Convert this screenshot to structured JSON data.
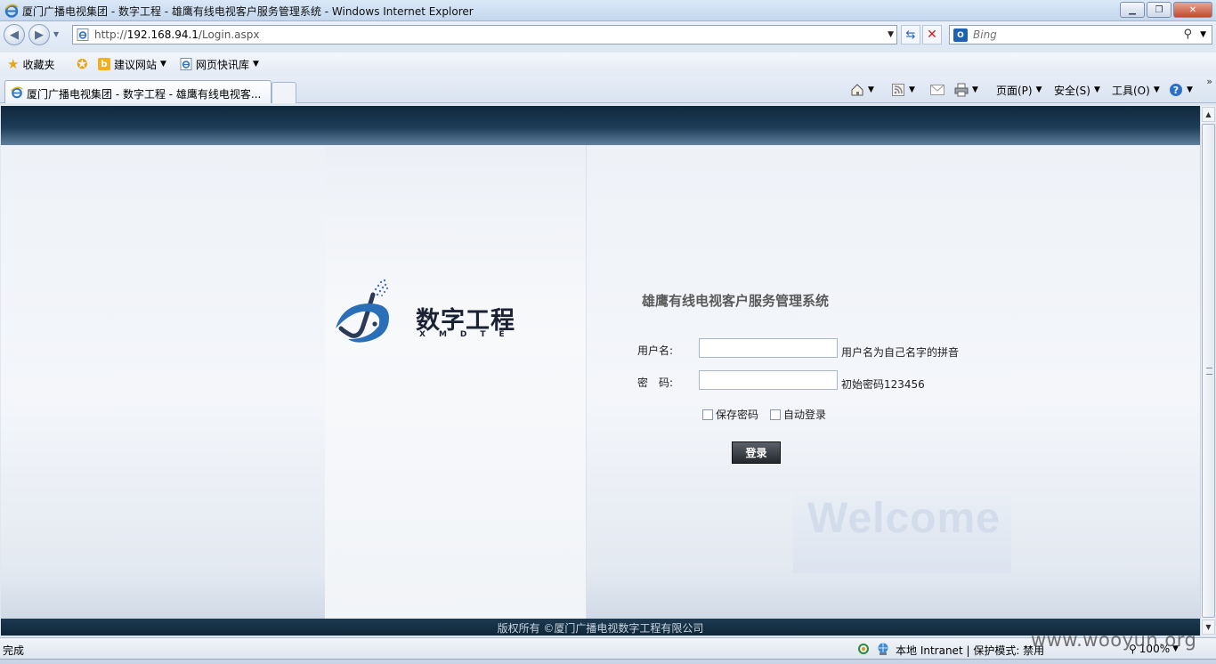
{
  "window": {
    "title": "厦门广播电视集团 - 数字工程 - 雄鹰有线电视客户服务管理系统 - Windows Internet Explorer",
    "controls": {
      "minimize": "▁",
      "maximize": "❐",
      "close": "✕"
    }
  },
  "address_bar": {
    "url_prefix": "http://",
    "url_host": "192.168.94.1",
    "url_path": "/Login.aspx",
    "search_placeholder": "Bing"
  },
  "favorites_bar": {
    "favorites_label": "收藏夹",
    "items": [
      {
        "label": "建议网站",
        "icon": "bing-icon"
      },
      {
        "label": "网页快讯库",
        "icon": "ie-page-icon"
      }
    ]
  },
  "tabs": [
    {
      "label": "厦门广播电视集团 - 数字工程 - 雄鹰有线电视客..."
    }
  ],
  "command_bar": {
    "page_menu": "页面(P)",
    "safety_menu": "安全(S)",
    "tools_menu": "工具(O)"
  },
  "page": {
    "logo": {
      "text_cn": "数字工程",
      "text_en": "XMDTE"
    },
    "system_title": "雄鹰有线电视客户服务管理系统",
    "username_label": "用户名:",
    "username_value": "",
    "username_hint": "用户名为自己名字的拼音",
    "password_label": "密　码:",
    "password_value": "",
    "password_hint": "初始密码123456",
    "remember_password_label": "保存密码",
    "remember_password_checked": false,
    "auto_login_label": "自动登录",
    "auto_login_checked": false,
    "login_button": "登录",
    "welcome_text": "Welcome",
    "copyright": "版权所有 ©厦门广播电视数字工程有限公司"
  },
  "status_bar": {
    "status": "完成",
    "zone": "本地 Intranet | 保护模式: 禁用",
    "zoom": "100%"
  },
  "watermark": "www.wooyun.org",
  "colors": {
    "header_dark": "#10283c",
    "footer_dark": "#0f2638",
    "button_dark": "#24282e",
    "logo_blue": "#2a6fb8"
  }
}
